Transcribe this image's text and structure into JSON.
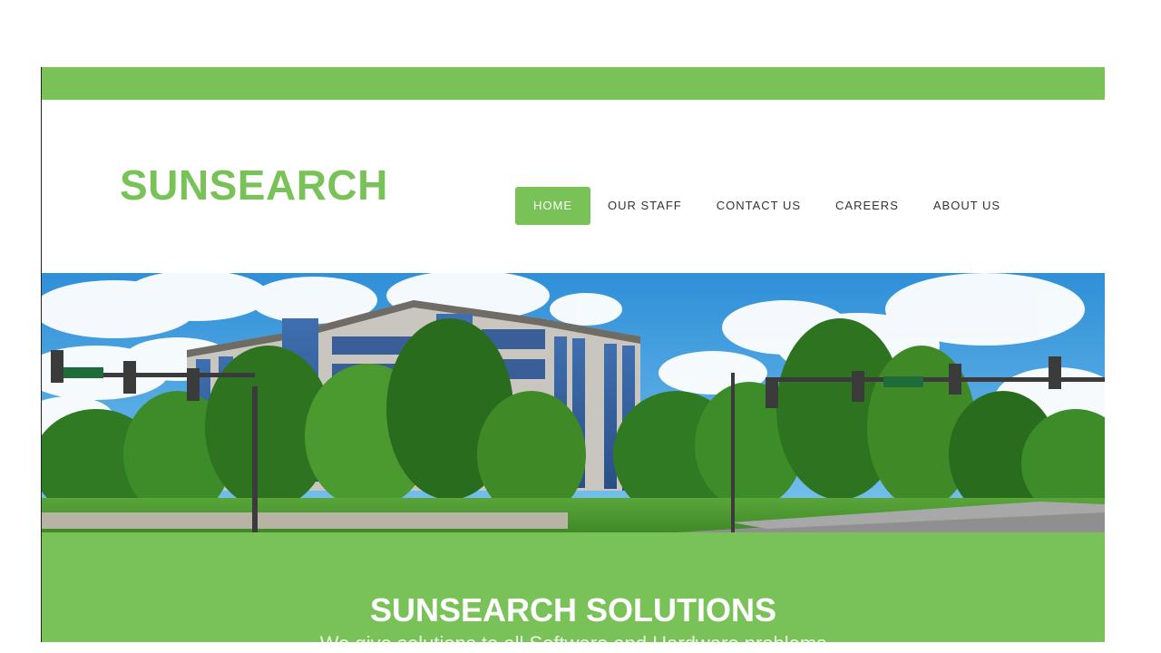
{
  "site": {
    "logo": "SUNSEARCH"
  },
  "nav": {
    "items": [
      {
        "label": "HOME",
        "active": true
      },
      {
        "label": "OUR STAFF",
        "active": false
      },
      {
        "label": "CONTACT US",
        "active": false
      },
      {
        "label": "CAREERS",
        "active": false
      },
      {
        "label": "ABOUT US",
        "active": false
      }
    ]
  },
  "banner": {
    "title": "SUNSEARCH SOLUTIONS",
    "subtitle": "We give solutions to all Software and Hardware problems"
  },
  "colors": {
    "accent": "#79c257",
    "text_dark": "#333333",
    "white": "#ffffff"
  },
  "hero": {
    "image": "office-building-photo"
  }
}
